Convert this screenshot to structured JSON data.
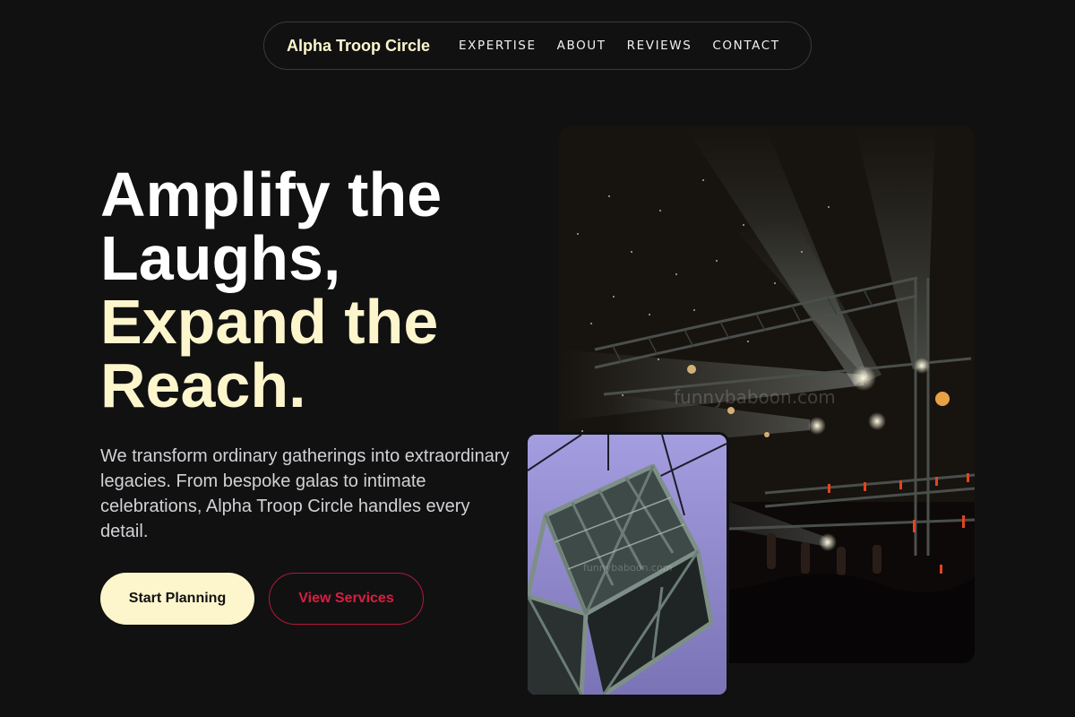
{
  "nav": {
    "brand": "Alpha Troop Circle",
    "links": [
      "EXPERTISE",
      "ABOUT",
      "REVIEWS",
      "CONTACT"
    ]
  },
  "hero": {
    "title_line1": "Amplify the",
    "title_line2": "Laughs,",
    "title_line3": "Expand the",
    "title_line4": "Reach.",
    "description": "We transform ordinary gatherings into extraordinary legacies. From bespoke galas to intimate celebrations, Alpha Troop Circle handles every detail.",
    "primary_button": "Start Planning",
    "secondary_button": "View Services"
  },
  "images": {
    "main_watermark": "funnybaboon.com",
    "inset_watermark": "funnybaboon.com"
  },
  "colors": {
    "background": "#111112",
    "cream": "#fdf6cd",
    "accent_red": "#d91e42"
  }
}
